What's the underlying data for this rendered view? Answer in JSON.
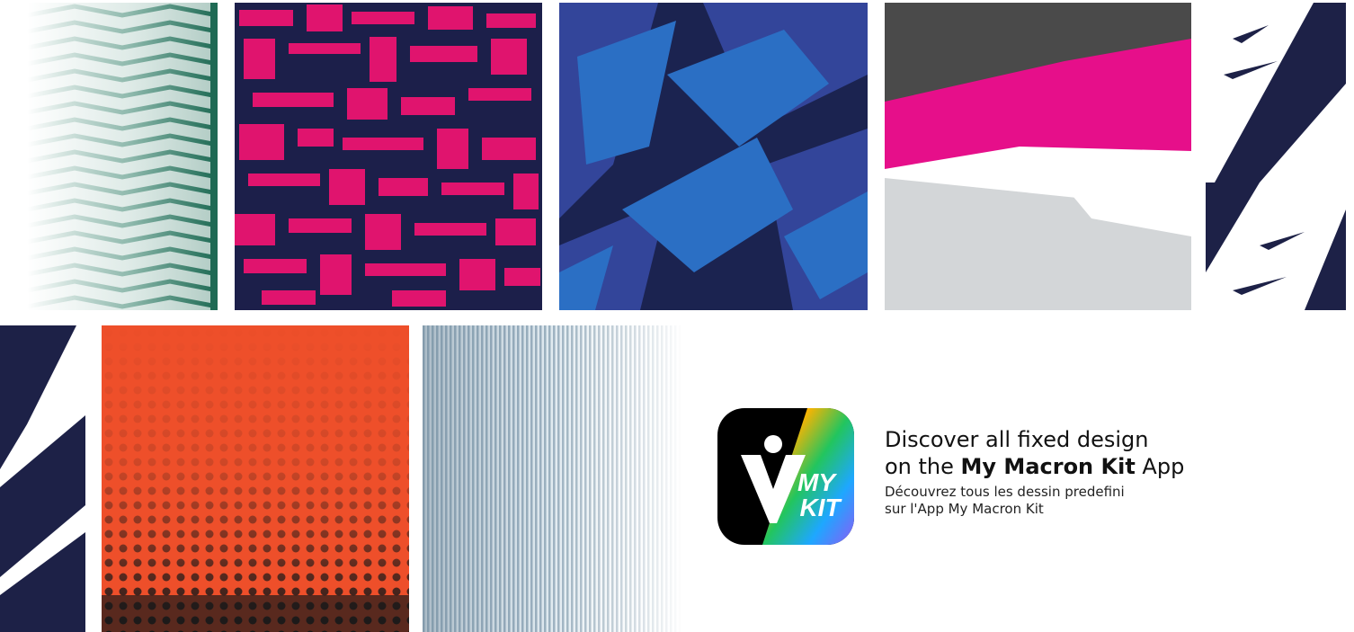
{
  "promo": {
    "headline_line1": "Discover all fixed design",
    "headline_line2_prefix": "on the ",
    "headline_line2_bold": "My Macron Kit",
    "headline_line2_suffix": " App",
    "subline_line1": "Découvrez tous les dessin predefini",
    "subline_line2": "sur l'App My Macron Kit"
  },
  "app_icon": {
    "icon": "my-macron-kit-app-icon",
    "label_line1": "MY",
    "label_line2": "KIT"
  },
  "swatches": [
    {
      "name": "teal-chevron-gradient",
      "colors": [
        "#ffffff",
        "#2a7a63"
      ]
    },
    {
      "name": "magenta-navy-camo",
      "colors": [
        "#e0146e",
        "#1c1f4a"
      ]
    },
    {
      "name": "blue-brush-strokes",
      "colors": [
        "#2b6fc4",
        "#1b2350",
        "#33459a"
      ]
    },
    {
      "name": "grey-pink-white-brush",
      "colors": [
        "#4a4a4a",
        "#e60f8a",
        "#ffffff",
        "#d3d6d8"
      ]
    },
    {
      "name": "navy-white-slash-right",
      "colors": [
        "#1d2147",
        "#ffffff"
      ]
    },
    {
      "name": "navy-white-slash-left",
      "colors": [
        "#1d2147",
        "#ffffff"
      ]
    },
    {
      "name": "orange-halftone-grunge",
      "colors": [
        "#ee4f2a",
        "#1a1a1a"
      ]
    },
    {
      "name": "blue-vertical-lines-gradient",
      "colors": [
        "#2f5774",
        "#ffffff"
      ]
    }
  ]
}
